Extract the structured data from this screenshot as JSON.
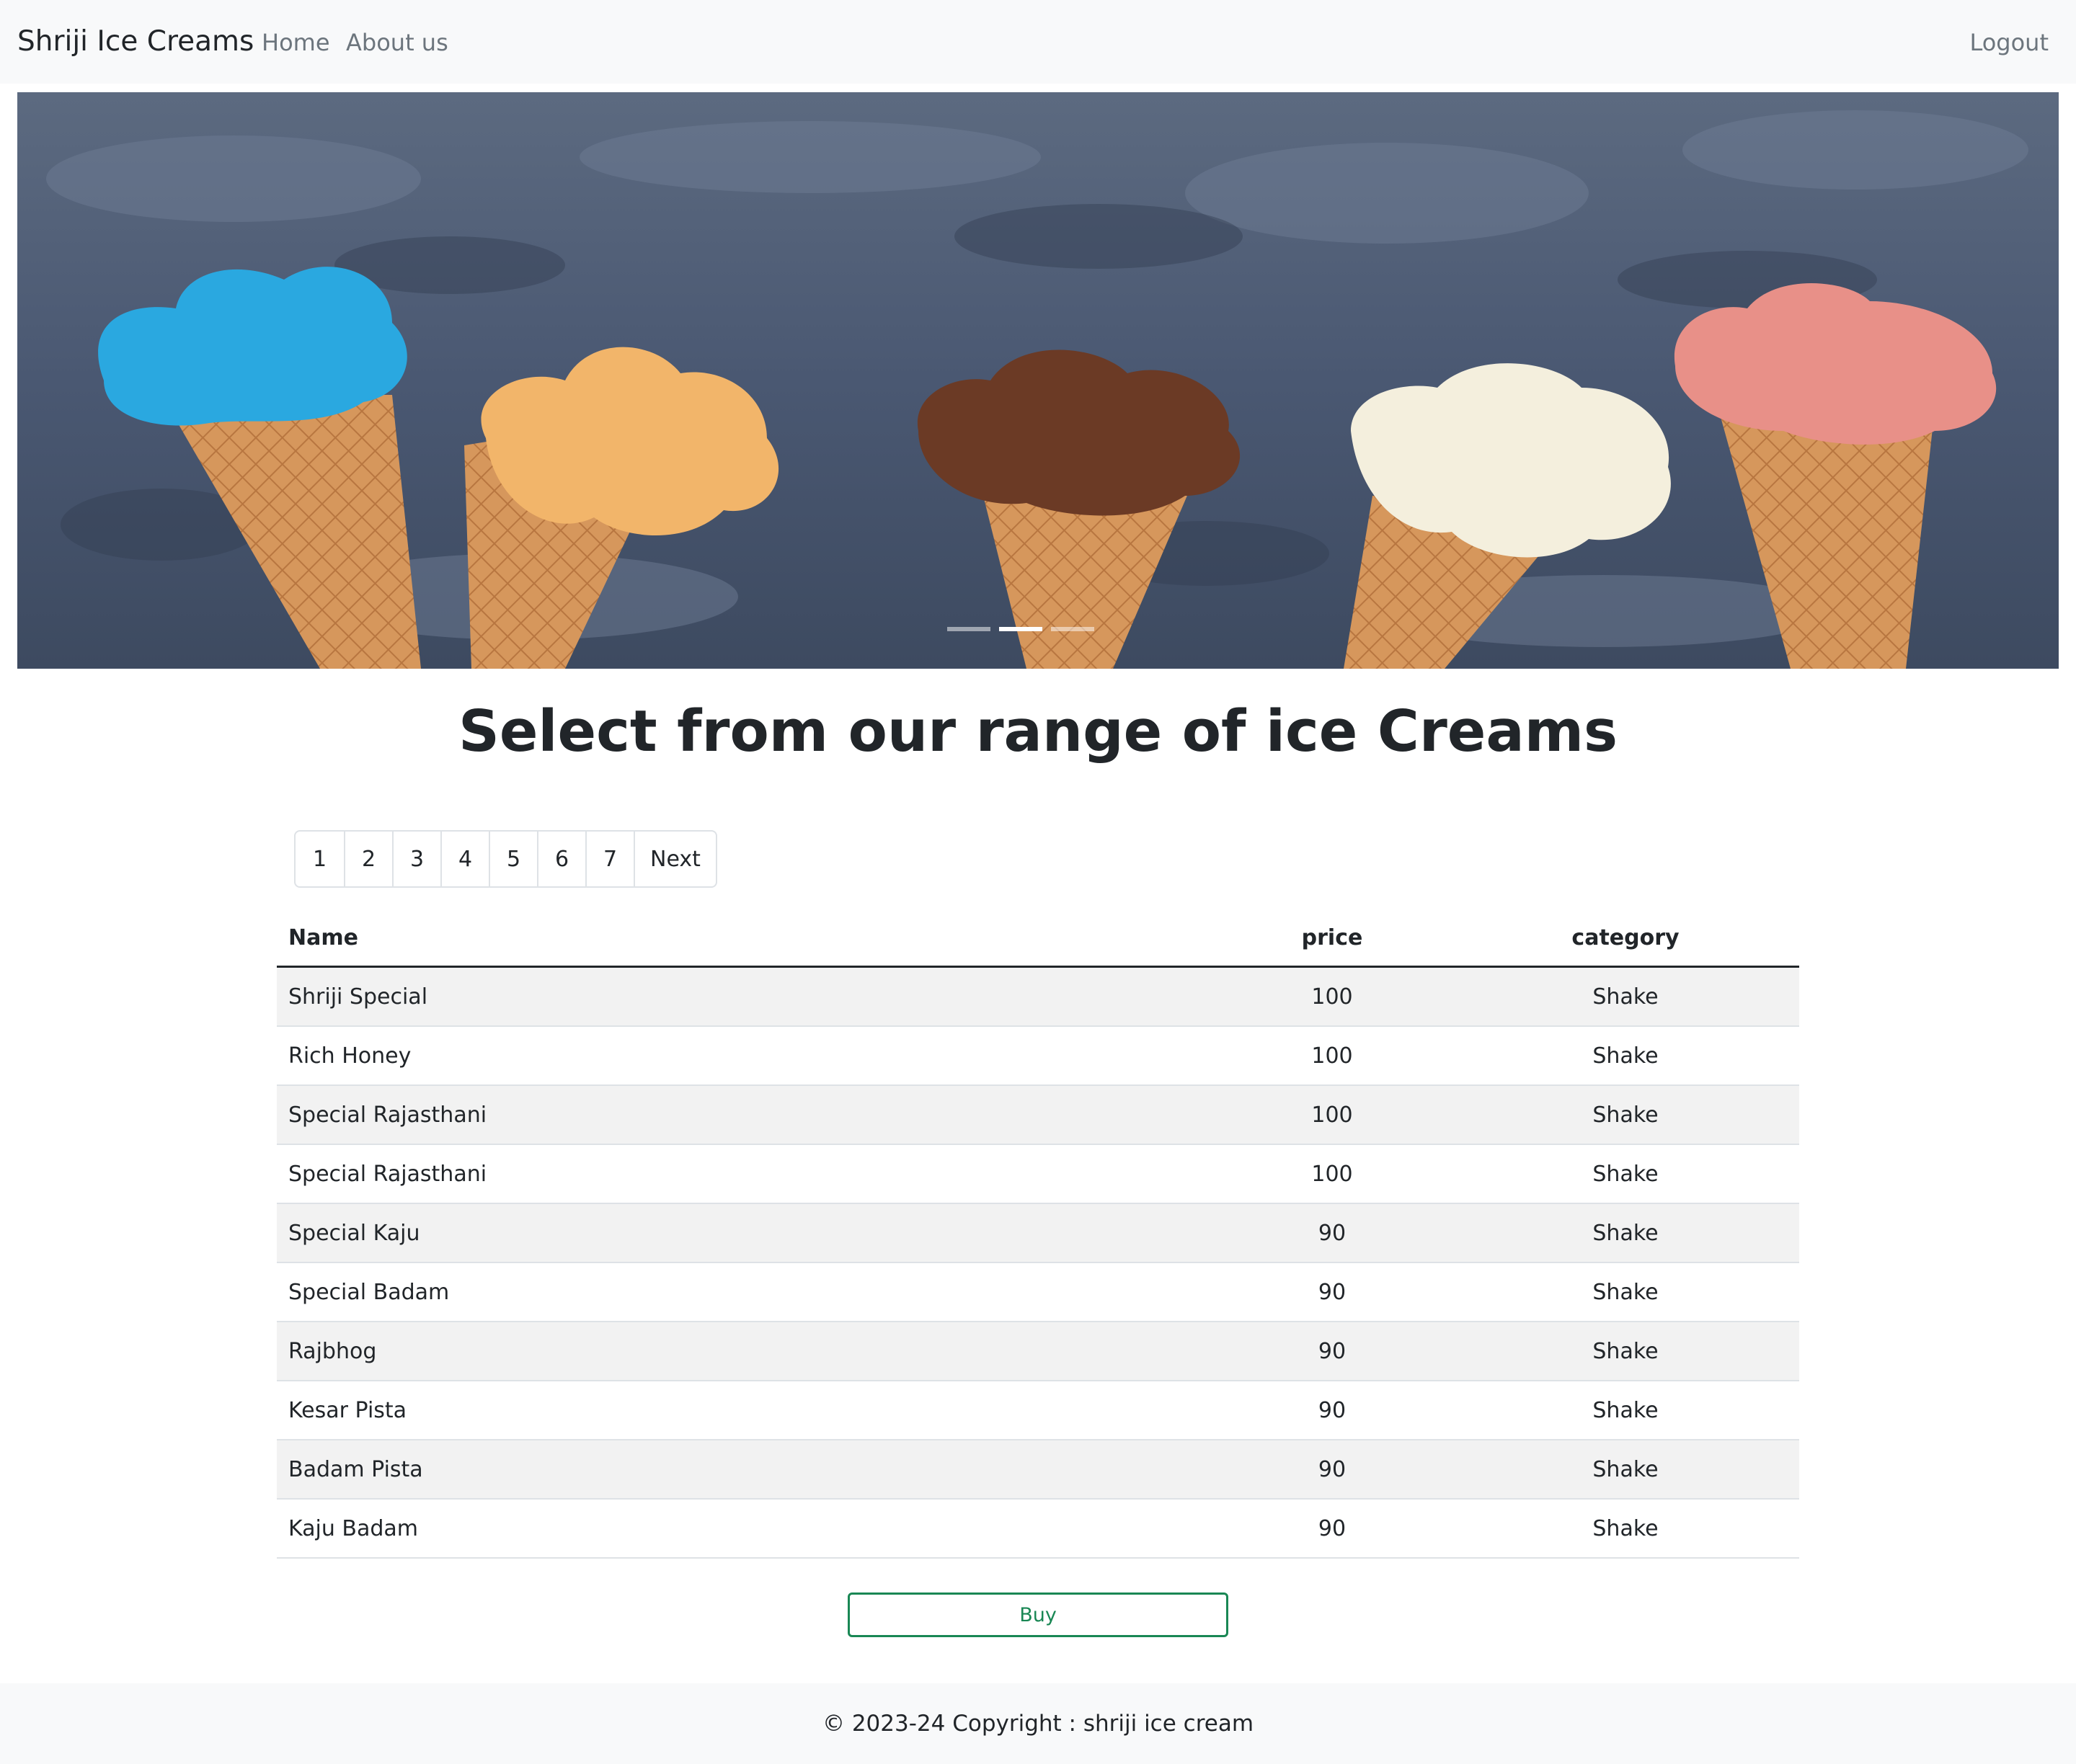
{
  "navbar": {
    "brand": "Shriji Ice Creams",
    "links": [
      "Home",
      "About us"
    ],
    "logout": "Logout"
  },
  "carousel": {
    "image_name": "ice-cream-cones-banner",
    "slide_count": 3,
    "active_slide": 2,
    "scoop_colors": [
      "#2aa8e0",
      "#f2b56a",
      "#6b3a25",
      "#f4efdd",
      "#e89088"
    ]
  },
  "main": {
    "heading": "Select from our range of ice Creams"
  },
  "pagination": {
    "pages": [
      "1",
      "2",
      "3",
      "4",
      "5",
      "6",
      "7"
    ],
    "next": "Next"
  },
  "table": {
    "headers": [
      "Name",
      "price",
      "category"
    ],
    "rows": [
      {
        "name": "Shriji Special",
        "price": "100",
        "category": "Shake"
      },
      {
        "name": "Rich Honey",
        "price": "100",
        "category": "Shake"
      },
      {
        "name": "Special Rajasthani",
        "price": "100",
        "category": "Shake"
      },
      {
        "name": "Special Rajasthani",
        "price": "100",
        "category": "Shake"
      },
      {
        "name": "Special Kaju",
        "price": "90",
        "category": "Shake"
      },
      {
        "name": "Special Badam",
        "price": "90",
        "category": "Shake"
      },
      {
        "name": "Rajbhog",
        "price": "90",
        "category": "Shake"
      },
      {
        "name": "Kesar Pista",
        "price": "90",
        "category": "Shake"
      },
      {
        "name": "Badam Pista",
        "price": "90",
        "category": "Shake"
      },
      {
        "name": "Kaju Badam",
        "price": "90",
        "category": "Shake"
      }
    ]
  },
  "buy_label": "Buy",
  "footer": {
    "text": "© 2023-24 Copyright : shriji ice cream"
  },
  "colors": {
    "navbar_bg": "#f8f9fa",
    "success": "#198754",
    "muted": "#6c757d"
  }
}
